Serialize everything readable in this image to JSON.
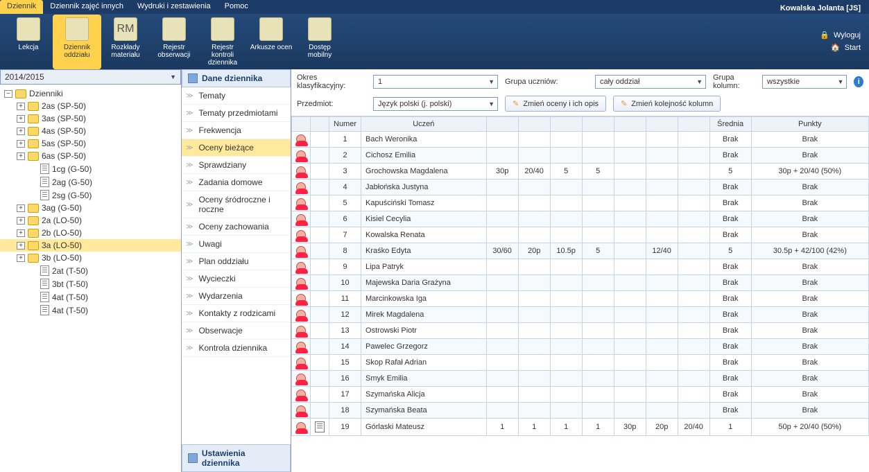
{
  "user": "Kowalska Jolanta [JS]",
  "top_tabs": [
    "Dziennik",
    "Dziennik zajęć innych",
    "Wydruki i zestawienia",
    "Pomoc"
  ],
  "top_tab_active": 0,
  "ribbon": [
    {
      "label": "Lekcja"
    },
    {
      "label": "Dziennik oddziału",
      "active": true
    },
    {
      "label": "Rozkłady materiału",
      "caption": "RM"
    },
    {
      "label": "Rejestr obserwacji"
    },
    {
      "label": "Rejestr kontroli dziennika"
    },
    {
      "label": "Arkusze ocen"
    },
    {
      "label": "Dostęp mobilny"
    }
  ],
  "ribbon_right": {
    "logout": "Wyloguj",
    "start": "Start"
  },
  "year": "2014/2015",
  "tree_root": "Dzienniki",
  "tree": [
    {
      "label": "2as (SP-50)",
      "type": "folder",
      "exp": "plus",
      "depth": 1
    },
    {
      "label": "3as (SP-50)",
      "type": "folder",
      "exp": "plus",
      "depth": 1
    },
    {
      "label": "4as (SP-50)",
      "type": "folder",
      "exp": "plus",
      "depth": 1
    },
    {
      "label": "5as (SP-50)",
      "type": "folder",
      "exp": "plus",
      "depth": 1
    },
    {
      "label": "6as (SP-50)",
      "type": "folder",
      "exp": "plus",
      "depth": 1
    },
    {
      "label": "1cg (G-50)",
      "type": "page",
      "depth": 2
    },
    {
      "label": "2ag (G-50)",
      "type": "page",
      "depth": 2
    },
    {
      "label": "2sg (G-50)",
      "type": "page",
      "depth": 2
    },
    {
      "label": "3ag (G-50)",
      "type": "folder",
      "exp": "plus",
      "depth": 1
    },
    {
      "label": "2a (LO-50)",
      "type": "folder",
      "exp": "plus",
      "depth": 1
    },
    {
      "label": "2b (LO-50)",
      "type": "folder",
      "exp": "plus",
      "depth": 1
    },
    {
      "label": "3a (LO-50)",
      "type": "folder",
      "exp": "plus",
      "depth": 1,
      "selected": true
    },
    {
      "label": "3b (LO-50)",
      "type": "folder",
      "exp": "plus",
      "depth": 1
    },
    {
      "label": "2at (T-50)",
      "type": "page",
      "depth": 2
    },
    {
      "label": "3bt (T-50)",
      "type": "page",
      "depth": 2
    },
    {
      "label": "4at (T-50)",
      "type": "page",
      "depth": 2
    },
    {
      "label": "4at (T-50)",
      "type": "page",
      "depth": 2
    }
  ],
  "mid_header": "Dane dziennika",
  "mid_footer": "Ustawienia dziennika",
  "nav": [
    "Tematy",
    "Tematy przedmiotami",
    "Frekwencja",
    "Oceny bieżące",
    "Sprawdziany",
    "Zadania domowe",
    "Oceny śródroczne i roczne",
    "Oceny zachowania",
    "Uwagi",
    "Plan oddziału",
    "Wycieczki",
    "Wydarzenia",
    "Kontakty z rodzicami",
    "Obserwacje",
    "Kontrola dziennika"
  ],
  "nav_active": 3,
  "filters": {
    "okres_label": "Okres klasyfikacyjny:",
    "okres_value": "1",
    "grupa_u_label": "Grupa uczniów:",
    "grupa_u_value": "cały oddział",
    "grupa_k_label": "Grupa kolumn:",
    "grupa_k_value": "wszystkie",
    "przedmiot_label": "Przedmiot:",
    "przedmiot_value": "Język polski (j. polski)",
    "btn_oceny": "Zmień oceny i ich opis",
    "btn_kolumny": "Zmień kolejność kolumn"
  },
  "grid_headers": {
    "numer": "Numer",
    "uczen": "Uczeń",
    "srednia": "Średnia",
    "punkty": "Punkty"
  },
  "rows": [
    {
      "n": 1,
      "name": "Bach Weronika",
      "g": [
        "",
        "",
        "",
        "",
        "",
        "",
        ""
      ],
      "sr": "Brak",
      "pk": "Brak"
    },
    {
      "n": 2,
      "name": "Cichosz Emilia",
      "g": [
        "",
        "",
        "",
        "",
        "",
        "",
        ""
      ],
      "sr": "Brak",
      "pk": "Brak"
    },
    {
      "n": 3,
      "name": "Grochowska Magdalena",
      "g": [
        "30p",
        "20/40",
        "5",
        "5",
        "",
        "",
        ""
      ],
      "sr": "5",
      "pk": "30p + 20/40 (50%)"
    },
    {
      "n": 4,
      "name": "Jabłońska Justyna",
      "g": [
        "",
        "",
        "",
        "",
        "",
        "",
        ""
      ],
      "sr": "Brak",
      "pk": "Brak"
    },
    {
      "n": 5,
      "name": "Kapuściński Tomasz",
      "g": [
        "",
        "",
        "",
        "",
        "",
        "",
        ""
      ],
      "sr": "Brak",
      "pk": "Brak"
    },
    {
      "n": 6,
      "name": "Kisiel Cecylia",
      "g": [
        "",
        "",
        "",
        "",
        "",
        "",
        ""
      ],
      "sr": "Brak",
      "pk": "Brak"
    },
    {
      "n": 7,
      "name": "Kowalska Renata",
      "g": [
        "",
        "",
        "",
        "",
        "",
        "",
        ""
      ],
      "sr": "Brak",
      "pk": "Brak"
    },
    {
      "n": 8,
      "name": "Kraśko Edyta",
      "g": [
        "30/60",
        "20p",
        "10.5p",
        "5",
        "",
        "12/40",
        ""
      ],
      "sr": "5",
      "pk": "30.5p + 42/100 (42%)"
    },
    {
      "n": 9,
      "name": "Lipa Patryk",
      "g": [
        "",
        "",
        "",
        "",
        "",
        "",
        ""
      ],
      "sr": "Brak",
      "pk": "Brak"
    },
    {
      "n": 10,
      "name": "Majewska Daria Grażyna",
      "g": [
        "",
        "",
        "",
        "",
        "",
        "",
        ""
      ],
      "sr": "Brak",
      "pk": "Brak"
    },
    {
      "n": 11,
      "name": "Marcinkowska Iga",
      "g": [
        "",
        "",
        "",
        "",
        "",
        "",
        ""
      ],
      "sr": "Brak",
      "pk": "Brak"
    },
    {
      "n": 12,
      "name": "Mirek Magdalena",
      "g": [
        "",
        "",
        "",
        "",
        "",
        "",
        ""
      ],
      "sr": "Brak",
      "pk": "Brak"
    },
    {
      "n": 13,
      "name": "Ostrowski Piotr",
      "g": [
        "",
        "",
        "",
        "",
        "",
        "",
        ""
      ],
      "sr": "Brak",
      "pk": "Brak"
    },
    {
      "n": 14,
      "name": "Pawelec Grzegorz",
      "g": [
        "",
        "",
        "",
        "",
        "",
        "",
        ""
      ],
      "sr": "Brak",
      "pk": "Brak"
    },
    {
      "n": 15,
      "name": "Skop Rafał Adrian",
      "g": [
        "",
        "",
        "",
        "",
        "",
        "",
        ""
      ],
      "sr": "Brak",
      "pk": "Brak"
    },
    {
      "n": 16,
      "name": "Smyk Emilia",
      "g": [
        "",
        "",
        "",
        "",
        "",
        "",
        ""
      ],
      "sr": "Brak",
      "pk": "Brak"
    },
    {
      "n": 17,
      "name": "Szymańska Alicja",
      "g": [
        "",
        "",
        "",
        "",
        "",
        "",
        ""
      ],
      "sr": "Brak",
      "pk": "Brak"
    },
    {
      "n": 18,
      "name": "Szymańska Beata",
      "g": [
        "",
        "",
        "",
        "",
        "",
        "",
        ""
      ],
      "sr": "Brak",
      "pk": "Brak"
    },
    {
      "n": 19,
      "name": "Górlaski Mateusz",
      "doc": true,
      "g": [
        "1",
        "1",
        "1",
        "1",
        "30p",
        "20p",
        "20/40"
      ],
      "sr": "1",
      "pk": "50p + 20/40 (50%)"
    }
  ]
}
